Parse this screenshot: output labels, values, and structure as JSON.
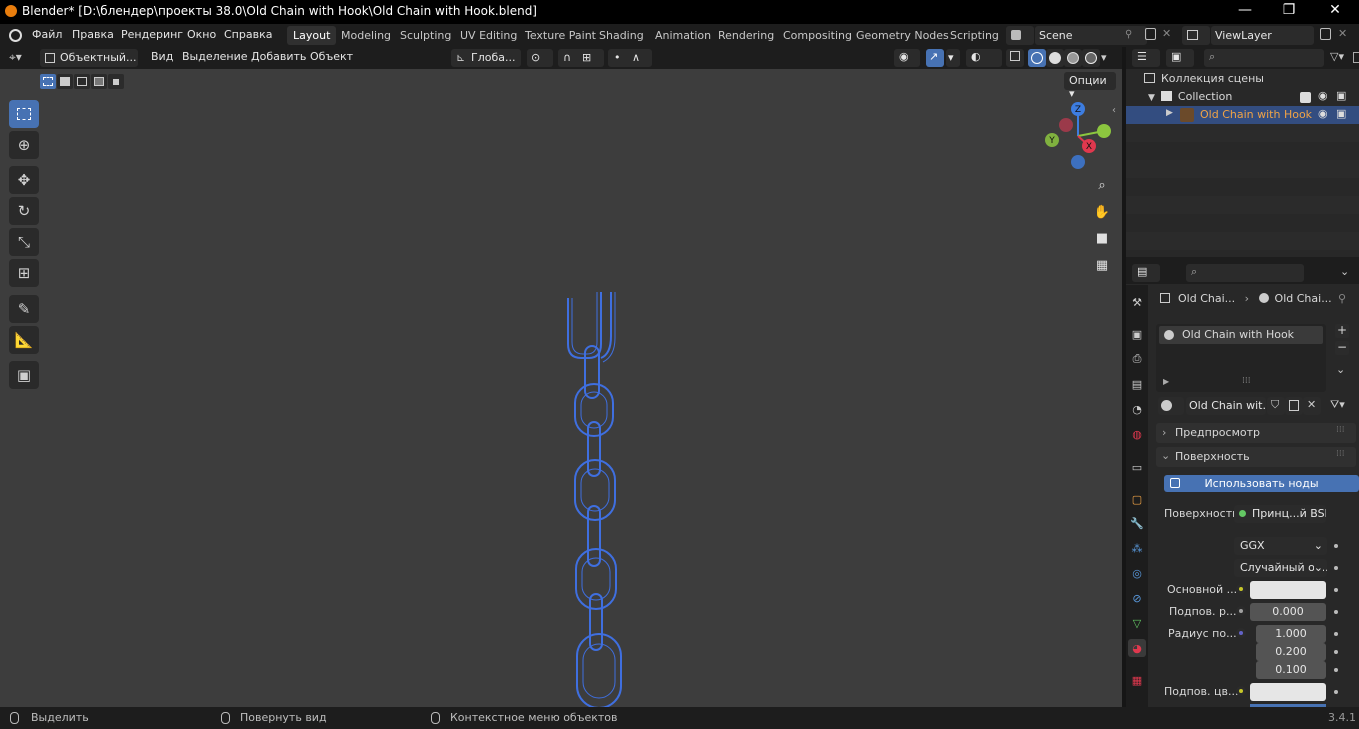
{
  "window": {
    "title": "Blender* [D:\\блендер\\проекты 38.0\\Old Chain with Hook\\Old Chain with Hook.blend]",
    "minimize": "—",
    "maximize": "❐",
    "close": "✕"
  },
  "menu": [
    "Файл",
    "Правка",
    "Рендеринг",
    "Окно",
    "Справка"
  ],
  "workspaces": [
    "Layout",
    "Modeling",
    "Sculpting",
    "UV Editing",
    "Texture Paint",
    "Shading",
    "Animation",
    "Rendering",
    "Compositing",
    "Geometry Nodes",
    "Scripting"
  ],
  "active_workspace": "Layout",
  "scene": {
    "name": "Scene",
    "view_layer": "ViewLayer"
  },
  "viewport_header": {
    "mode": "Объектный...",
    "menus": [
      "Вид",
      "Выделение",
      "Добавить",
      "Объект"
    ],
    "orientation": "Глоба...",
    "options": "Опции"
  },
  "outliner": {
    "root": "Коллекция сцены",
    "collection": "Collection",
    "object": "Old Chain with Hook"
  },
  "properties": {
    "breadcrumb_object": "Old Chai...",
    "breadcrumb_material": "Old Chai...",
    "slot_material": "Old Chain with Hook",
    "material_name": "Old Chain wit...",
    "panels": {
      "preview": "Предпросмотр",
      "surface": "Поверхность"
    },
    "use_nodes_button": "Использовать ноды",
    "surface_label": "Поверхность",
    "surface_shader": "Принц...й BSDF",
    "distribution": "GGX",
    "subsurface_method": "Случайный об...",
    "base_color_label": "Основной ...",
    "subsurface_label": "Подпов. р...",
    "subsurface_value": "0.000",
    "radius_label": "Радиус по...",
    "radius_values": [
      "1.000",
      "0.200",
      "0.100"
    ],
    "subsurface_color_label": "Подпов. цв..."
  },
  "statusbar": {
    "select": "Выделить",
    "rotate": "Повернуть вид",
    "context": "Контекстное меню объектов",
    "version": "3.4.1"
  },
  "colors": {
    "accent": "#4772b3",
    "wire": "#3f6fe0",
    "viewport_bg": "#3d3d3d",
    "object_selected": "#f0a346",
    "gizmo_x": "#e0384e",
    "gizmo_y": "#8cc63f",
    "gizmo_z": "#3d7de0"
  },
  "icons": [
    "blender-logo-icon",
    "select-box-icon",
    "cursor-icon",
    "move-icon",
    "rotate-icon",
    "scale-icon",
    "transform-icon",
    "annotate-icon",
    "measure-icon",
    "add-cube-icon",
    "zoom-icon",
    "hand-icon",
    "camera-icon",
    "grid-icon",
    "eye-icon",
    "camera-render-icon",
    "search-icon",
    "filter-icon",
    "pin-icon",
    "plus-icon",
    "minus-icon"
  ]
}
